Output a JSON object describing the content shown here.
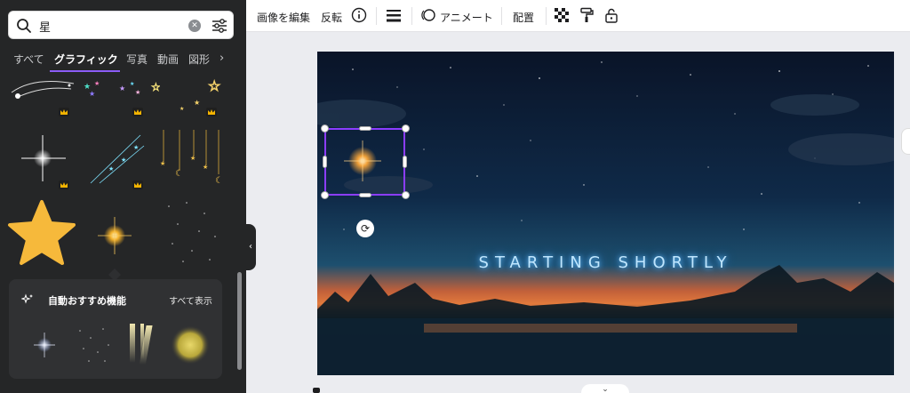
{
  "search": {
    "value": "星"
  },
  "tabs": [
    {
      "label": "すべて"
    },
    {
      "label": "グラフィック"
    },
    {
      "label": "写真"
    },
    {
      "label": "動画"
    },
    {
      "label": "図形"
    }
  ],
  "recommend": {
    "title": "自動おすすめ機能",
    "show_all": "すべて表示"
  },
  "toolbar": {
    "edit_image": "画像を編集",
    "flip": "反転",
    "animate": "アニメート",
    "position": "配置"
  },
  "canvas": {
    "title": "STARTING SHORTLY"
  },
  "colors": {
    "accent": "#8b3dff",
    "panel": "#252627",
    "star": "#f6b93b"
  },
  "icons": [
    "search-icon",
    "clear-icon",
    "filter-icon",
    "chevron-right-icon",
    "crown-icon",
    "info-icon",
    "lines-icon",
    "animate-icon",
    "transparency-icon",
    "paint-roller-icon",
    "lock-icon",
    "rotate-icon",
    "sparkle-icon"
  ]
}
